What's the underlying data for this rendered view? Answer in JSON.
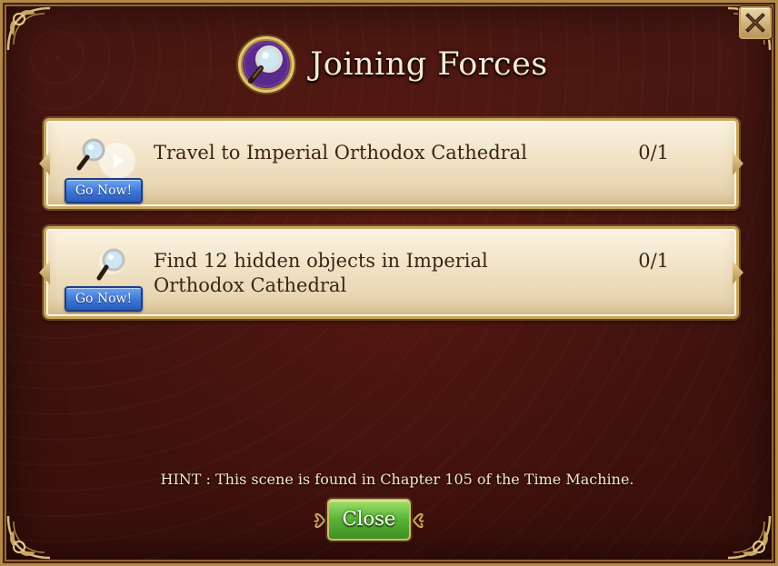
{
  "window": {
    "title": "Joining Forces",
    "close_icon": "x-close-icon"
  },
  "tasks": [
    {
      "label": "Travel to Imperial Orthodox Cathedral",
      "progress": "0/1",
      "button": "Go Now!",
      "icon": "magnifying-glass-play-icon"
    },
    {
      "label_line1": "Find 12 hidden objects in Imperial",
      "label_line2": "Orthodox Cathedral",
      "progress": "0/1",
      "button": "Go Now!",
      "icon": "magnifying-glass-icon"
    }
  ],
  "hint": "HINT : This scene is found in Chapter 105 of the Time Machine.",
  "close_button": "Close",
  "colors": {
    "background": "#3a0f0b",
    "gold": "#c9a75e",
    "go_button": "#3f78d8",
    "close_button": "#58b236"
  }
}
